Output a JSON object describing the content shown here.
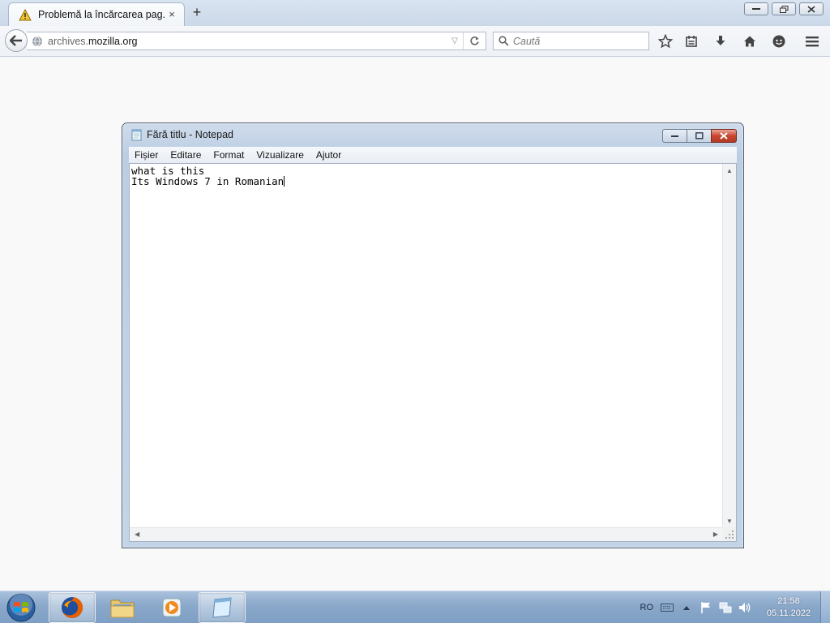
{
  "browser": {
    "tab_title": "Problemă la încărcarea pag...",
    "tab_close": "×",
    "new_tab": "+",
    "url_prefix": "archives.",
    "url_domain": "mozilla.org",
    "search_placeholder": "Caută"
  },
  "notepad": {
    "title": "Fără titlu - Notepad",
    "menu": [
      "Fișier",
      "Editare",
      "Format",
      "Vizualizare",
      "Ajutor"
    ],
    "text_line_1": "what is this",
    "text_line_2": "Its Windows 7 in Romanian"
  },
  "taskbar": {
    "language": "RO",
    "time": "21:58",
    "date": "05.11.2022"
  }
}
